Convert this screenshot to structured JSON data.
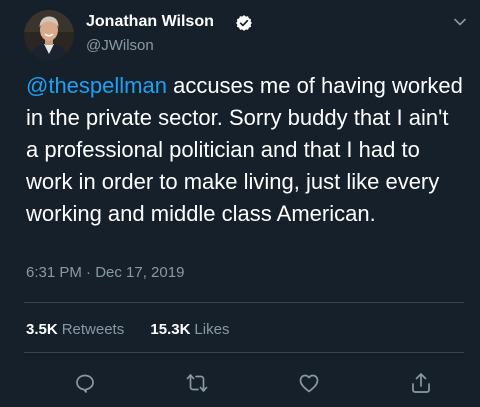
{
  "author": {
    "display_name": "Jonathan Wilson",
    "handle": "@JWilson",
    "verified": true,
    "avatar": "profile-photo"
  },
  "tweet": {
    "mention": "@thespellman",
    "text": " accuses me of having worked in the private sector. Sorry buddy that I ain't a professional politician and that I had to work in order to make living, just like every working and middle class American.",
    "timestamp": "6:31 PM · Dec 17, 2019"
  },
  "stats": {
    "retweets_count": "3.5K",
    "retweets_label": "Retweets",
    "likes_count": "15.3K",
    "likes_label": "Likes"
  },
  "actions": [
    "reply-icon",
    "retweet-icon",
    "like-icon",
    "share-icon"
  ],
  "colors": {
    "background": "#15202b",
    "text": "#ffffff",
    "secondary": "#8899a6",
    "link": "#1da1f2",
    "divider": "#38444d"
  }
}
